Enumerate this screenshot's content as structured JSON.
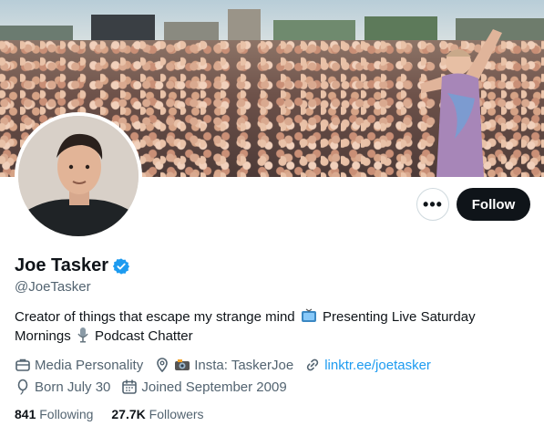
{
  "profile": {
    "name": "Joe Tasker",
    "handle": "@JoeTasker",
    "bio_part1": "Creator of things that escape my strange mind",
    "bio_part2": "Presenting Live Saturday Mornings",
    "bio_part3": "Podcast Chatter",
    "category": "Media Personality",
    "location": "Insta: TaskerJoe",
    "website": "linktr.ee/joetasker",
    "born": "Born July 30",
    "joined": "Joined September 2009"
  },
  "actions": {
    "more_label": "•••",
    "follow_label": "Follow"
  },
  "stats": {
    "following_count": "841",
    "following_label": "Following",
    "followers_count": "27.7K",
    "followers_label": "Followers"
  },
  "icons": {
    "verified": "verified-badge-icon",
    "category": "briefcase-icon",
    "location": "location-pin-icon",
    "link": "link-icon",
    "born": "balloon-icon",
    "joined": "calendar-icon"
  },
  "colors": {
    "accent": "#1d9bf0",
    "primary_text": "#0f1419",
    "secondary_text": "#536471",
    "follow_button": "#0f1419"
  }
}
